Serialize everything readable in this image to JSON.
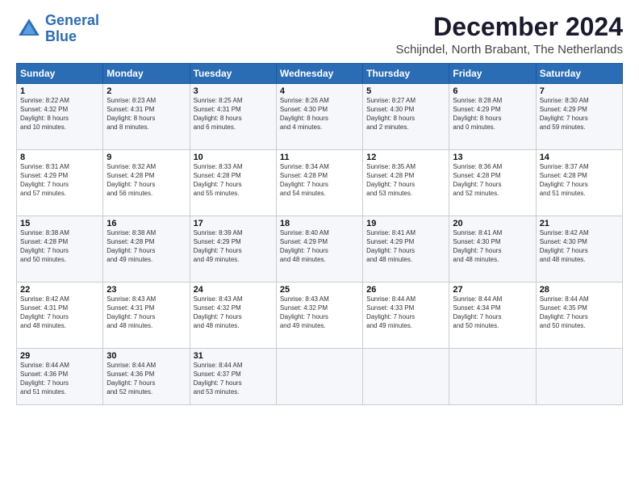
{
  "logo": {
    "line1": "General",
    "line2": "Blue"
  },
  "title": "December 2024",
  "subtitle": "Schijndel, North Brabant, The Netherlands",
  "weekdays": [
    "Sunday",
    "Monday",
    "Tuesday",
    "Wednesday",
    "Thursday",
    "Friday",
    "Saturday"
  ],
  "days": [
    {
      "num": "",
      "info": ""
    },
    {
      "num": "",
      "info": ""
    },
    {
      "num": "",
      "info": ""
    },
    {
      "num": "",
      "info": ""
    },
    {
      "num": "",
      "info": ""
    },
    {
      "num": "",
      "info": ""
    },
    {
      "num": "",
      "info": ""
    },
    {
      "num": "1",
      "info": "Sunrise: 8:22 AM\nSunset: 4:32 PM\nDaylight: 8 hours and 10 minutes."
    },
    {
      "num": "2",
      "info": "Sunrise: 8:23 AM\nSunset: 4:31 PM\nDaylight: 8 hours and 8 minutes."
    },
    {
      "num": "3",
      "info": "Sunrise: 8:25 AM\nSunset: 4:31 PM\nDaylight: 8 hours and 6 minutes."
    },
    {
      "num": "4",
      "info": "Sunrise: 8:26 AM\nSunset: 4:30 PM\nDaylight: 8 hours and 4 minutes."
    },
    {
      "num": "5",
      "info": "Sunrise: 8:27 AM\nSunset: 4:30 PM\nDaylight: 8 hours and 2 minutes."
    },
    {
      "num": "6",
      "info": "Sunrise: 8:28 AM\nSunset: 4:29 PM\nDaylight: 8 hours and 0 minutes."
    },
    {
      "num": "7",
      "info": "Sunrise: 8:30 AM\nSunset: 4:29 PM\nDaylight: 7 hours and 59 minutes."
    },
    {
      "num": "8",
      "info": "Sunrise: 8:31 AM\nSunset: 4:29 PM\nDaylight: 7 hours and 57 minutes."
    },
    {
      "num": "9",
      "info": "Sunrise: 8:32 AM\nSunset: 4:28 PM\nDaylight: 7 hours and 56 minutes."
    },
    {
      "num": "10",
      "info": "Sunrise: 8:33 AM\nSunset: 4:28 PM\nDaylight: 7 hours and 55 minutes."
    },
    {
      "num": "11",
      "info": "Sunrise: 8:34 AM\nSunset: 4:28 PM\nDaylight: 7 hours and 54 minutes."
    },
    {
      "num": "12",
      "info": "Sunrise: 8:35 AM\nSunset: 4:28 PM\nDaylight: 7 hours and 53 minutes."
    },
    {
      "num": "13",
      "info": "Sunrise: 8:36 AM\nSunset: 4:28 PM\nDaylight: 7 hours and 52 minutes."
    },
    {
      "num": "14",
      "info": "Sunrise: 8:37 AM\nSunset: 4:28 PM\nDaylight: 7 hours and 51 minutes."
    },
    {
      "num": "15",
      "info": "Sunrise: 8:38 AM\nSunset: 4:28 PM\nDaylight: 7 hours and 50 minutes."
    },
    {
      "num": "16",
      "info": "Sunrise: 8:38 AM\nSunset: 4:28 PM\nDaylight: 7 hours and 49 minutes."
    },
    {
      "num": "17",
      "info": "Sunrise: 8:39 AM\nSunset: 4:29 PM\nDaylight: 7 hours and 49 minutes."
    },
    {
      "num": "18",
      "info": "Sunrise: 8:40 AM\nSunset: 4:29 PM\nDaylight: 7 hours and 48 minutes."
    },
    {
      "num": "19",
      "info": "Sunrise: 8:41 AM\nSunset: 4:29 PM\nDaylight: 7 hours and 48 minutes."
    },
    {
      "num": "20",
      "info": "Sunrise: 8:41 AM\nSunset: 4:30 PM\nDaylight: 7 hours and 48 minutes."
    },
    {
      "num": "21",
      "info": "Sunrise: 8:42 AM\nSunset: 4:30 PM\nDaylight: 7 hours and 48 minutes."
    },
    {
      "num": "22",
      "info": "Sunrise: 8:42 AM\nSunset: 4:31 PM\nDaylight: 7 hours and 48 minutes."
    },
    {
      "num": "23",
      "info": "Sunrise: 8:43 AM\nSunset: 4:31 PM\nDaylight: 7 hours and 48 minutes."
    },
    {
      "num": "24",
      "info": "Sunrise: 8:43 AM\nSunset: 4:32 PM\nDaylight: 7 hours and 48 minutes."
    },
    {
      "num": "25",
      "info": "Sunrise: 8:43 AM\nSunset: 4:32 PM\nDaylight: 7 hours and 49 minutes."
    },
    {
      "num": "26",
      "info": "Sunrise: 8:44 AM\nSunset: 4:33 PM\nDaylight: 7 hours and 49 minutes."
    },
    {
      "num": "27",
      "info": "Sunrise: 8:44 AM\nSunset: 4:34 PM\nDaylight: 7 hours and 50 minutes."
    },
    {
      "num": "28",
      "info": "Sunrise: 8:44 AM\nSunset: 4:35 PM\nDaylight: 7 hours and 50 minutes."
    },
    {
      "num": "29",
      "info": "Sunrise: 8:44 AM\nSunset: 4:36 PM\nDaylight: 7 hours and 51 minutes."
    },
    {
      "num": "30",
      "info": "Sunrise: 8:44 AM\nSunset: 4:36 PM\nDaylight: 7 hours and 52 minutes."
    },
    {
      "num": "31",
      "info": "Sunrise: 8:44 AM\nSunset: 4:37 PM\nDaylight: 7 hours and 53 minutes."
    },
    {
      "num": "",
      "info": ""
    },
    {
      "num": "",
      "info": ""
    },
    {
      "num": "",
      "info": ""
    },
    {
      "num": "",
      "info": ""
    }
  ]
}
